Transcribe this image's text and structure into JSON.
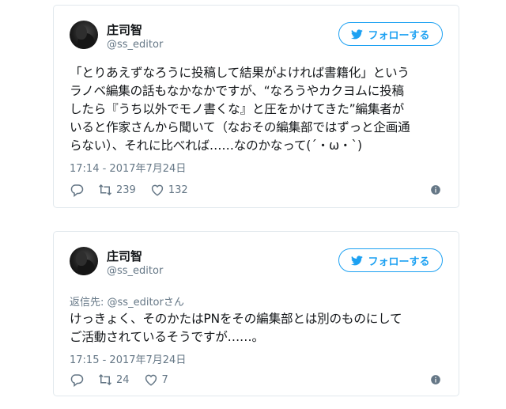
{
  "tweets": [
    {
      "display_name": "庄司智",
      "handle": "@ss_editor",
      "follow_label": "フォローする",
      "text": "「とりあえずなろうに投稿して結果がよければ書籍化」という\nラノベ編集の話もなかなかですが、“なろうやカクヨムに投稿\nしたら『うち以外でモノ書くな』と圧をかけてきた”編集者が\nいると作家さんから聞いて（なおその編集部ではずっと企画通\nらない）、それに比べれば……なのかなって(´・ω・`)",
      "timestamp": "17:14 - 2017年7月24日",
      "retweet_count": "239",
      "like_count": "132"
    },
    {
      "display_name": "庄司智",
      "handle": "@ss_editor",
      "follow_label": "フォローする",
      "reply_prefix": "返信先:",
      "reply_to": "@ss_editorさん",
      "text": "けっきょく、そのかたはPNをその編集部とは別のものにして\nご活動されているそうですが……。",
      "timestamp": "17:15 - 2017年7月24日",
      "retweet_count": "24",
      "like_count": "7"
    }
  ],
  "icons": {
    "follow": "twitter-bird-icon",
    "reply": "reply-icon",
    "retweet": "retweet-icon",
    "like": "heart-icon",
    "info": "info-icon"
  },
  "colors": {
    "accent": "#1da1f2",
    "muted": "#657786",
    "text": "#14171a",
    "border": "#e1e8ed"
  }
}
